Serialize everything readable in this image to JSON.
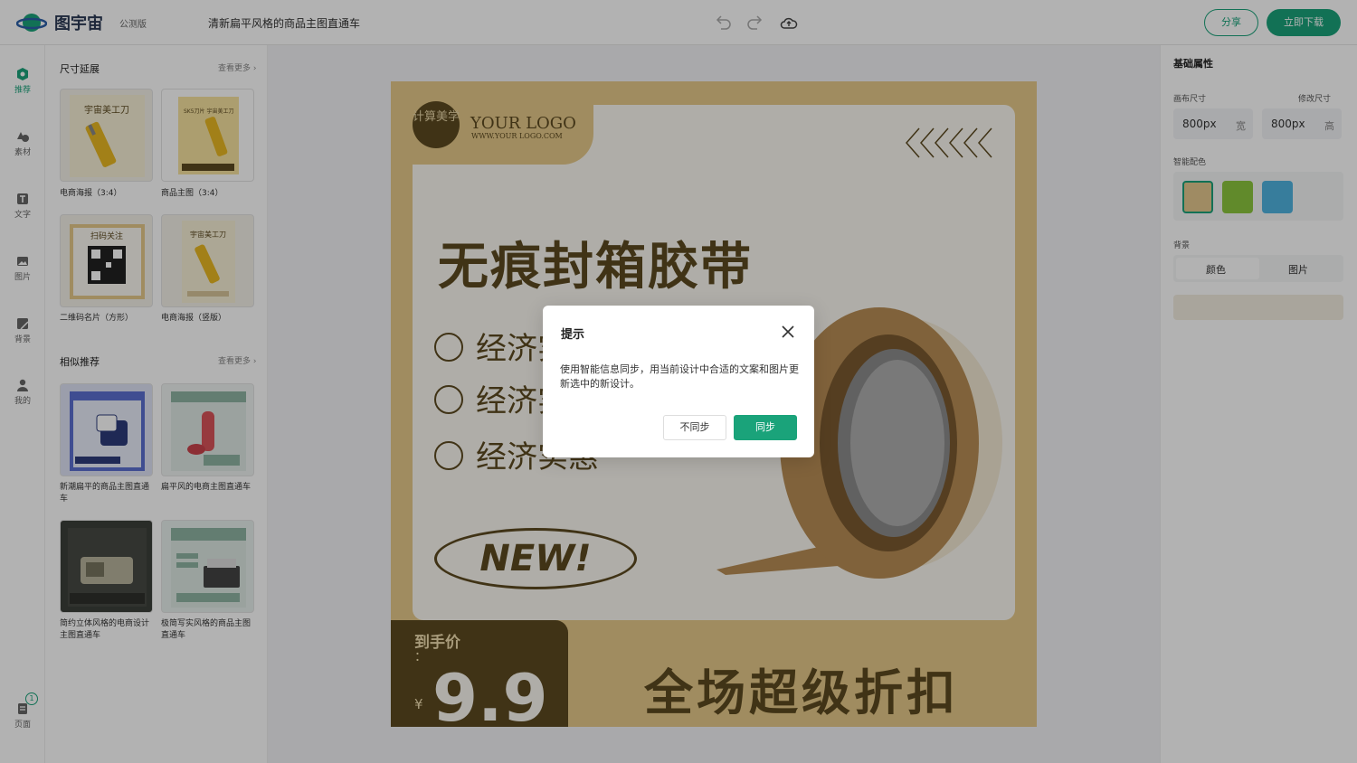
{
  "app": {
    "brand": "图宇宙",
    "edition": "公测版",
    "document_title": "清新扁平风格的商品主图直通车"
  },
  "toolbar": {
    "share_label": "分享",
    "download_label": "立即下载"
  },
  "rail": {
    "items": [
      {
        "label": "推荐",
        "icon": "recommend-icon"
      },
      {
        "label": "素材",
        "icon": "shapes-icon"
      },
      {
        "label": "文字",
        "icon": "text-icon"
      },
      {
        "label": "图片",
        "icon": "image-icon"
      },
      {
        "label": "背景",
        "icon": "background-icon"
      },
      {
        "label": "我的",
        "icon": "user-icon"
      }
    ],
    "pages_label": "页面",
    "pages_count": "1"
  },
  "library": {
    "section1": {
      "title": "尺寸延展",
      "more": "查看更多",
      "items": [
        {
          "caption": "电商海报（3:4）",
          "thumb_title": "宇宙美工刀"
        },
        {
          "caption": "商品主图（3:4）",
          "thumb_title": "SK5刀片 宇宙美工刀"
        },
        {
          "caption": "二维码名片（方形）",
          "thumb_title": "扫码关注"
        },
        {
          "caption": "电商海报（竖版）",
          "thumb_title": "宇宙美工刀"
        }
      ]
    },
    "section2": {
      "title": "相似推荐",
      "more": "查看更多",
      "items": [
        {
          "caption": "新潮扁平的商品主图直通车"
        },
        {
          "caption": "扁平风的电商主图直通车"
        },
        {
          "caption": "简约立体风格的电商设计主图直通车"
        },
        {
          "caption": "极简写实风格的商品主图直通车"
        }
      ]
    }
  },
  "properties": {
    "title": "基础属性",
    "canvas_size_label": "画布尺寸",
    "resize_link": "修改尺寸",
    "width_value": "800px",
    "width_unit": "宽",
    "height_value": "800px",
    "height_unit": "高",
    "smart_color_label": "智能配色",
    "swatches": [
      "#e4c88f",
      "#8cc63e",
      "#4fb3e0"
    ],
    "background_label": "背景",
    "bg_options": [
      "颜色",
      "图片"
    ]
  },
  "poster": {
    "logo_circle": "计算美学",
    "logo_text": "YOUR LOGO",
    "logo_sub": "WWW.YOUR LOGO.COM",
    "headline": "无痕封箱胶带",
    "bullets": [
      "经济实惠",
      "经济实惠",
      "经济实惠"
    ],
    "new_badge": "NEW!",
    "price_label": "到手价",
    "price_colon": "：",
    "price_currency": "¥",
    "price_value": "9.9",
    "promo_text": "全场超级折扣",
    "colors": {
      "gold": "#e6c98a",
      "brown": "#5c4a20",
      "cream": "#fbf8f1"
    }
  },
  "modal": {
    "title": "提示",
    "body": "使用智能信息同步，用当前设计中合适的文案和图片更新选中的新设计。",
    "cancel_label": "不同步",
    "confirm_label": "同步"
  }
}
